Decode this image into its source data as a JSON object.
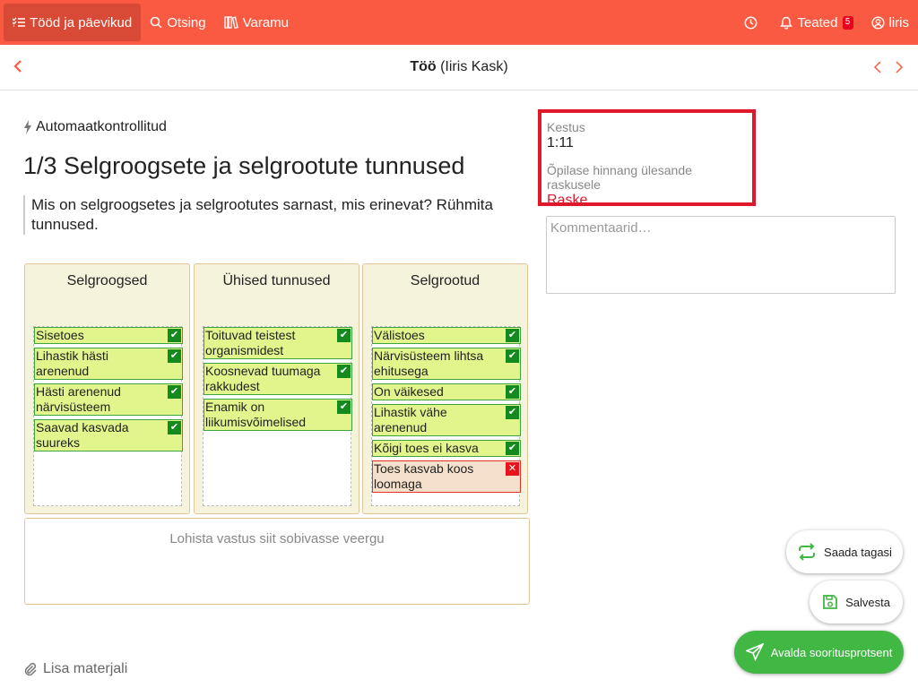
{
  "nav": {
    "tasks_label": "Tööd ja päevikud",
    "search_label": "Otsing",
    "library_label": "Varamu",
    "notifications_label": "Teated",
    "notifications_count": "5",
    "user_label": "liris"
  },
  "header": {
    "title_bold": "Töö",
    "title_rest": " (Iiris Kask)"
  },
  "task": {
    "auto_label": "Automaatkontrollitud",
    "title": "1/3 Selgroogsete ja selgrootute tunnused",
    "question": "Mis on selgroogsetes ja selgrootutes sarnast, mis erinevat? Rühmita tunnused."
  },
  "columns": [
    {
      "header": "Selgroogsed",
      "items": [
        {
          "text": "Sisetoes",
          "status": "correct"
        },
        {
          "text": "Lihastik hästi arenenud",
          "status": "correct"
        },
        {
          "text": "Hästi arenenud närvisüsteem",
          "status": "correct"
        },
        {
          "text": "Saavad kasvada suureks",
          "status": "correct"
        }
      ]
    },
    {
      "header": "Ühised tunnused",
      "items": [
        {
          "text": "Toituvad teistest organismidest",
          "status": "correct"
        },
        {
          "text": "Koosnevad tuumaga rakkudest",
          "status": "correct"
        },
        {
          "text": "Enamik on liikumisvõimelised",
          "status": "correct"
        }
      ]
    },
    {
      "header": "Selgrootud",
      "items": [
        {
          "text": "Välistoes",
          "status": "correct"
        },
        {
          "text": "Närvisüsteem lihtsa ehitusega",
          "status": "correct"
        },
        {
          "text": "On väikesed",
          "status": "correct"
        },
        {
          "text": "Lihastik vähe arenenud",
          "status": "correct"
        },
        {
          "text": "Kõigi toes ei kasva",
          "status": "correct"
        },
        {
          "text": "Toes kasvab koos loomaga",
          "status": "wrong"
        }
      ]
    }
  ],
  "drop_area_label": "Lohista vastus siit sobivasse veergu",
  "attach_label": "Lisa materjali",
  "info": {
    "duration_label": "Kestus",
    "duration_value": "1:11",
    "difficulty_label": "Õpilase hinnang ülesande raskusele",
    "difficulty_value": "Raske"
  },
  "comment_placeholder": "Kommentaarid…",
  "buttons": {
    "resend": "Saada tagasi",
    "save": "Salvesta",
    "publish": "Avalda sooritusprotsent"
  },
  "colors": {
    "brand": "#fb5a42",
    "correct": "#14891e",
    "wrong": "#e8131c",
    "publish": "#42b844"
  }
}
